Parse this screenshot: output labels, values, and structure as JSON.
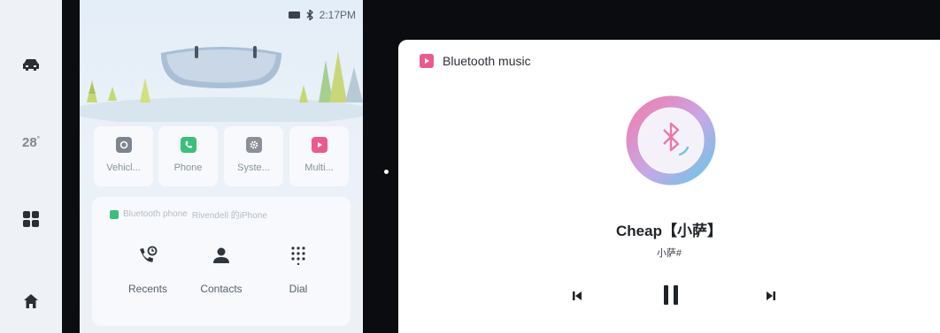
{
  "status_bar": {
    "time": "2:17PM"
  },
  "nav_rail": {
    "temperature": "28",
    "temperature_unit": "°"
  },
  "apps": [
    {
      "label": "Vehicl...",
      "icon": "vehicle-icon",
      "color": "#7c8590"
    },
    {
      "label": "Phone",
      "icon": "phone-icon",
      "color": "#3cbf7a"
    },
    {
      "label": "Syste...",
      "icon": "settings-icon",
      "color": "#8a8f98"
    },
    {
      "label": "Multi...",
      "icon": "media-icon",
      "color": "#ea5b8c"
    }
  ],
  "phone_card": {
    "bluetooth_label": "Bluetooth phone",
    "device_name": "Rivendell 的iPhone",
    "actions": [
      {
        "label": "Recents",
        "icon": "recents-icon"
      },
      {
        "label": "Contacts",
        "icon": "contacts-icon"
      },
      {
        "label": "Dial",
        "icon": "dialpad-icon"
      }
    ]
  },
  "music": {
    "source_title": "Bluetooth music",
    "song_title": "Cheap【小萨】",
    "artist": "小萨#",
    "state": "playing",
    "accent_color": "#ea5b8c"
  }
}
